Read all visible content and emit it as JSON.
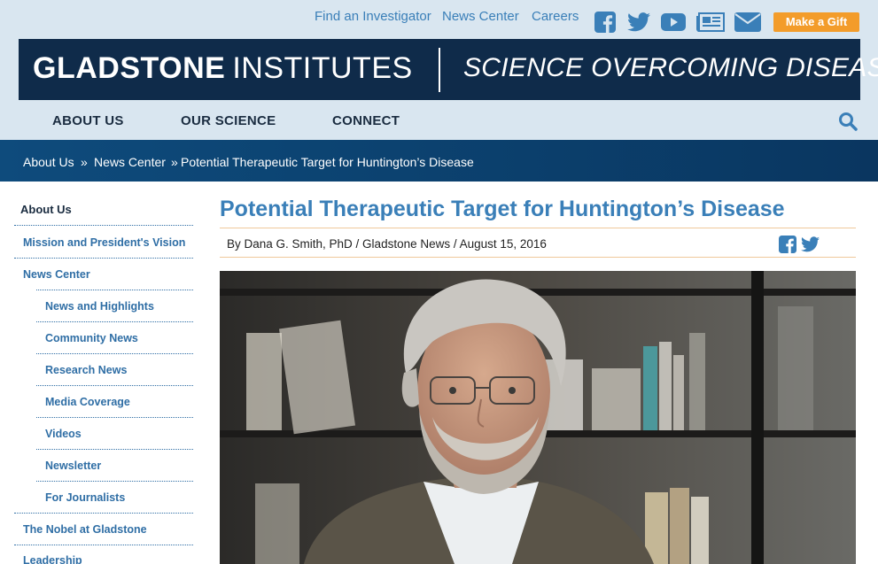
{
  "utility_nav": {
    "links": [
      "Find an Investigator",
      "News Center",
      "Careers"
    ],
    "social_icons": [
      "facebook-icon",
      "twitter-icon",
      "youtube-icon",
      "newsletter-icon",
      "email-icon"
    ],
    "gift_label": "Make a Gift"
  },
  "banner": {
    "brand_bold": "GLADSTONE",
    "brand_light": "INSTITUTES",
    "tagline": "SCIENCE OVERCOMING DISEASE"
  },
  "main_nav": {
    "items": [
      "ABOUT US",
      "OUR SCIENCE",
      "CONNECT"
    ],
    "search_icon": "search-icon"
  },
  "breadcrumb": {
    "items": [
      "About Us",
      "News Center",
      "Potential Therapeutic Target for Huntington’s Disease"
    ],
    "separator": "»"
  },
  "sidebar": {
    "heading": "About Us",
    "items": [
      {
        "label": "Mission and President's Vision",
        "level": 1
      },
      {
        "label": "News Center",
        "level": 1
      },
      {
        "label": "News and Highlights",
        "level": 2
      },
      {
        "label": "Community News",
        "level": 2
      },
      {
        "label": "Research News",
        "level": 2
      },
      {
        "label": "Media Coverage",
        "level": 2
      },
      {
        "label": "Videos",
        "level": 2
      },
      {
        "label": "Newsletter",
        "level": 2
      },
      {
        "label": "For Journalists",
        "level": 2
      },
      {
        "label": "The Nobel at Gladstone",
        "level": 1
      },
      {
        "label": "Leadership",
        "level": 1
      }
    ]
  },
  "article": {
    "title": "Potential Therapeutic Target for Huntington’s Disease",
    "byline": "By Dana G. Smith, PhD / Gladstone News / August 15, 2016",
    "share_icons": [
      "facebook-icon",
      "twitter-icon"
    ]
  },
  "colors": {
    "header_bg": "#d9e6f0",
    "banner_bg": "#0f2b4a",
    "link_blue": "#3a7fb8",
    "gift_orange": "#f39c2a",
    "crumb_bg": "#0e4b7c"
  }
}
